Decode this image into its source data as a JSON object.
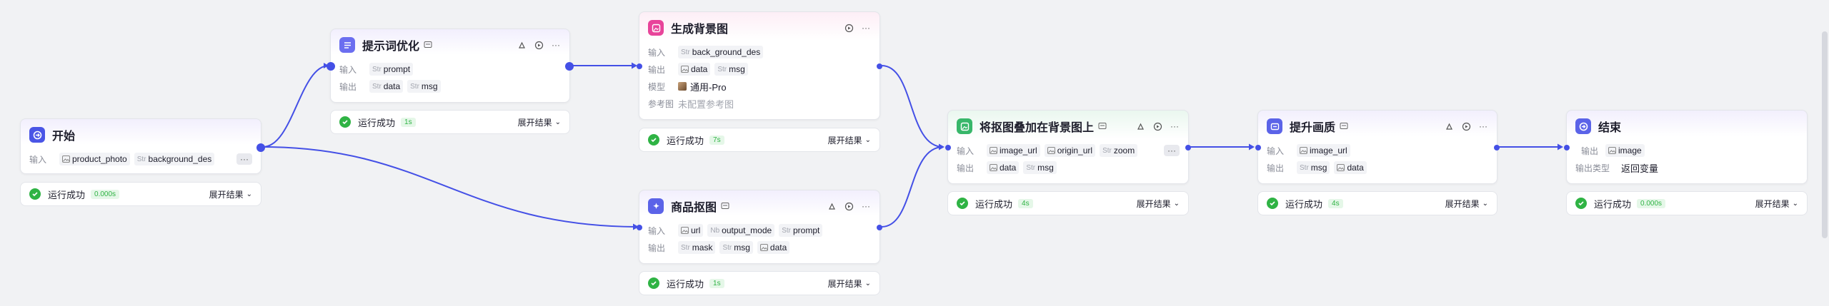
{
  "labels": {
    "input": "输入",
    "output": "输出",
    "model": "模型",
    "ref": "参考图",
    "out_type": "输出类型"
  },
  "status": {
    "success": "运行成功",
    "expand": "展开结果"
  },
  "colors": {
    "edge": "#4450e6",
    "success": "#2fb344"
  },
  "nodes": {
    "start": {
      "title": "开始",
      "icon": "start-icon",
      "icon_color": "#4a55e6",
      "inputs": [
        {
          "type": "img",
          "name": "product_photo"
        },
        {
          "type": "Str",
          "name": "background_des"
        }
      ],
      "time": "0.000s"
    },
    "prompt_opt": {
      "title": "提示词优化",
      "icon": "list-icon",
      "icon_color": "#6b6ef0",
      "inputs": [
        {
          "type": "Str",
          "name": "prompt"
        }
      ],
      "outputs": [
        {
          "type": "Str",
          "name": "data"
        },
        {
          "type": "Str",
          "name": "msg"
        }
      ],
      "time": "1s"
    },
    "gen_bg": {
      "title": "生成背景图",
      "icon": "image-gen-icon",
      "icon_color": "#e8449a",
      "inputs": [
        {
          "type": "Str",
          "name": "back_ground_des"
        }
      ],
      "outputs": [
        {
          "type": "img",
          "name": "data"
        },
        {
          "type": "Str",
          "name": "msg"
        }
      ],
      "model": "通用-Pro",
      "ref": "未配置参考图",
      "time": "7s"
    },
    "cutout": {
      "title": "商品抠图",
      "icon": "cutout-icon",
      "icon_color": "#5b63e8",
      "inputs": [
        {
          "type": "img",
          "name": "url"
        },
        {
          "type": "Nb",
          "name": "output_mode"
        },
        {
          "type": "Str",
          "name": "prompt"
        }
      ],
      "outputs": [
        {
          "type": "Str",
          "name": "mask"
        },
        {
          "type": "Str",
          "name": "msg"
        },
        {
          "type": "img",
          "name": "data"
        }
      ],
      "time": "1s"
    },
    "overlay": {
      "title": "将抠图叠加在背景图上",
      "icon": "overlay-icon",
      "icon_color": "#38b76a",
      "inputs": [
        {
          "type": "img",
          "name": "image_url"
        },
        {
          "type": "img",
          "name": "origin_url"
        },
        {
          "type": "Str",
          "name": "zoom"
        }
      ],
      "outputs": [
        {
          "type": "img",
          "name": "data"
        },
        {
          "type": "Str",
          "name": "msg"
        }
      ],
      "time": "4s"
    },
    "enhance": {
      "title": "提升画质",
      "icon": "enhance-icon",
      "icon_color": "#5b63e8",
      "inputs": [
        {
          "type": "img",
          "name": "image_url"
        }
      ],
      "outputs": [
        {
          "type": "Str",
          "name": "msg"
        },
        {
          "type": "img",
          "name": "data"
        }
      ],
      "time": "4s"
    },
    "end": {
      "title": "结束",
      "icon": "end-icon",
      "icon_color": "#5b63e8",
      "outputs": [
        {
          "type": "img",
          "name": "image"
        }
      ],
      "out_type": "返回变量",
      "time": "0.000s"
    }
  }
}
